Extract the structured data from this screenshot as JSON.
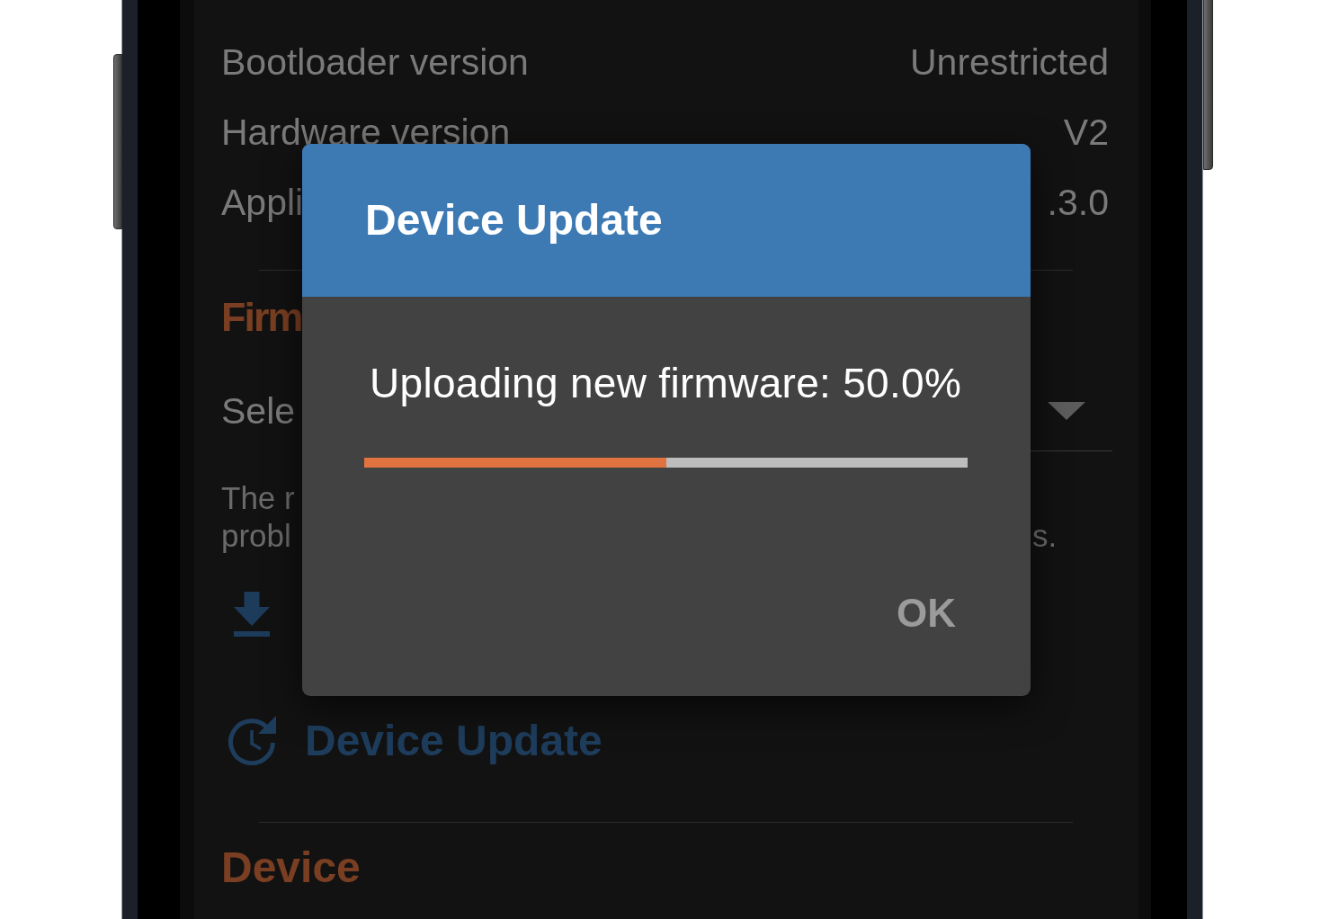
{
  "info_rows": [
    {
      "label": "Bootloader version",
      "value": "Unrestricted"
    },
    {
      "label": "Hardware version",
      "value": "V2"
    },
    {
      "label": "Appli",
      "value": ".3.0"
    }
  ],
  "firmware_section": {
    "title": "Firm",
    "select_label": "Sele",
    "note_lines": [
      {
        "start": "The r"
      },
      {
        "start": "probl",
        "end": "s."
      }
    ]
  },
  "update_button": {
    "label": "Device Update"
  },
  "device_section": {
    "title": "Device"
  },
  "dialog": {
    "title": "Device Update",
    "message": "Uploading new firmware: 50.0%",
    "progress": {
      "level": 0.5
    },
    "button": {
      "label": "OK",
      "disabled": true
    }
  }
}
